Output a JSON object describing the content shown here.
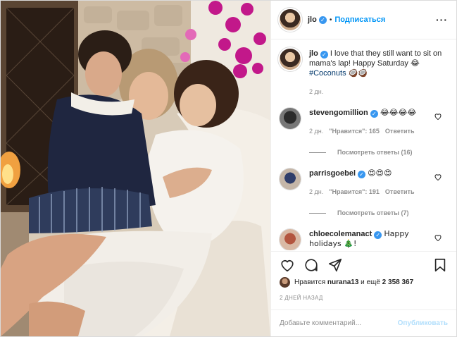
{
  "header": {
    "username": "jlo",
    "verified_mark": "✓",
    "separator": "•",
    "follow_label": "Подписаться",
    "more_label": "···"
  },
  "caption": {
    "username": "jlo",
    "text": "I love that they still want to sit on mama's lap! Happy Saturday 😂",
    "hashtag": "#Coconuts",
    "emojis": "🥥🥥",
    "time": "2 дн."
  },
  "comments": [
    {
      "username": "stevengomillion",
      "text": "😂😂😂😂",
      "time": "2 дн.",
      "likes": "\"Нравится\": 165",
      "reply": "Ответить",
      "view_replies": "Посмотреть ответы (16)"
    },
    {
      "username": "parrisgoebel",
      "text": "😍😍😍",
      "time": "2 дн.",
      "likes": "\"Нравится\": 191",
      "reply": "Ответить",
      "view_replies": "Посмотреть ответы (7)"
    },
    {
      "username": "chloecolemanact",
      "text": "Happy holidays 🎄!"
    }
  ],
  "likes_line": {
    "prefix": "Нравится",
    "user": "nurana13",
    "middle": "и ещё",
    "count": "2 358 367"
  },
  "date": "2 ДНЕЙ НАЗАД",
  "comment_input": {
    "placeholder": "Добавьте комментарий...",
    "post_label": "Опубликовать"
  },
  "colors": {
    "accent": "#0095f6",
    "verified": "#3897f0",
    "muted": "#8e8e8e",
    "text": "#262626",
    "hashtag": "#00376b"
  },
  "icons": [
    "heart-icon",
    "comment-icon",
    "share-icon",
    "bookmark-icon",
    "verified-icon",
    "more-icon"
  ]
}
